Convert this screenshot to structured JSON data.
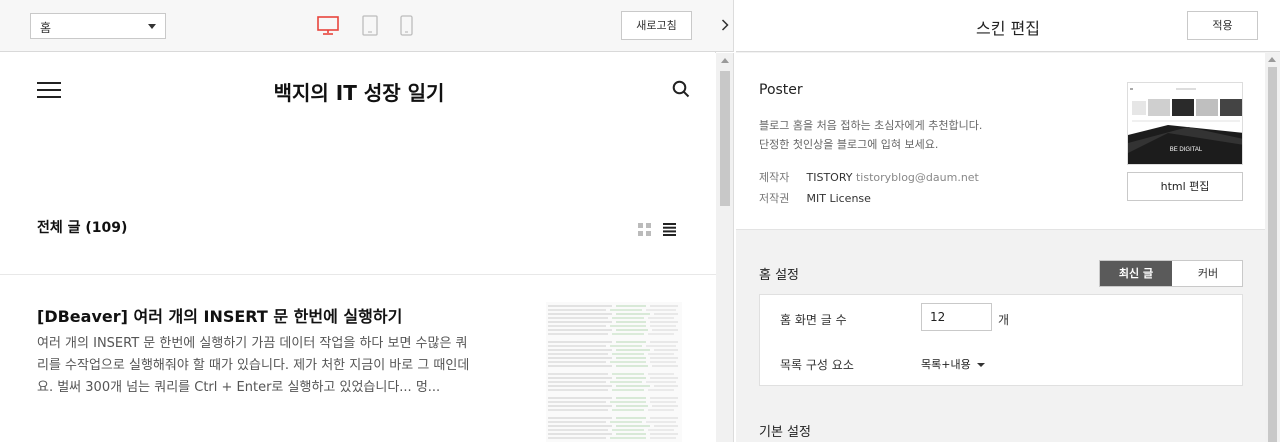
{
  "preview_toolbar": {
    "page_select": "홈",
    "refresh_label": "새로고침"
  },
  "blog": {
    "title": "백지의 IT 성장 일기",
    "post_count": "전체 글 (109)",
    "post": {
      "title": "[DBeaver] 여러 개의 INSERT 문 한번에 실행하기",
      "excerpt": "여러 개의 INSERT 문 한번에 실행하기 가끔 데이터 작업을 하다 보면 수많은 쿼리를 수작업으로 실행해줘야 할 때가 있습니다. 제가 처한 지금이 바로 그 때인데요. 벌써 300개 넘는 쿼리를 Ctrl + Enter로 실행하고 있었습니다... 멍..."
    }
  },
  "editor": {
    "title": "스킨 편집",
    "apply_label": "적용",
    "skin": {
      "name": "Poster",
      "desc_line1": "블로그 홈을 처음 접하는 초심자에게 추천합니다.",
      "desc_line2": "단정한 첫인상을 블로그에 입혀 보세요.",
      "maker_key": "제작자",
      "maker_value": "TISTORY",
      "maker_email": "tistoryblog@daum.net",
      "license_key": "저작권",
      "license_value": "MIT License",
      "thumb_caption": "BE DIGITAL",
      "html_edit_label": "html 편집"
    },
    "home_settings": {
      "label": "홈 설정",
      "toggle_active": "최신 글",
      "toggle_inactive": "커버",
      "count_label": "홈 화면 글 수",
      "count_value": "12",
      "count_unit": "개",
      "list_label": "목록 구성 요소",
      "list_value": "목록+내용"
    },
    "basic_settings_label": "기본 설정"
  },
  "colors": {
    "device_active": "#e8453c",
    "device_inactive": "#bdbdbd",
    "toggle_active_bg": "#5a5a5a"
  },
  "icons": [
    "desktop-icon",
    "tablet-icon",
    "mobile-icon",
    "hamburger-icon",
    "search-icon",
    "grid-view-icon",
    "list-view-icon",
    "chevron-right-icon",
    "caret-down-icon"
  ]
}
